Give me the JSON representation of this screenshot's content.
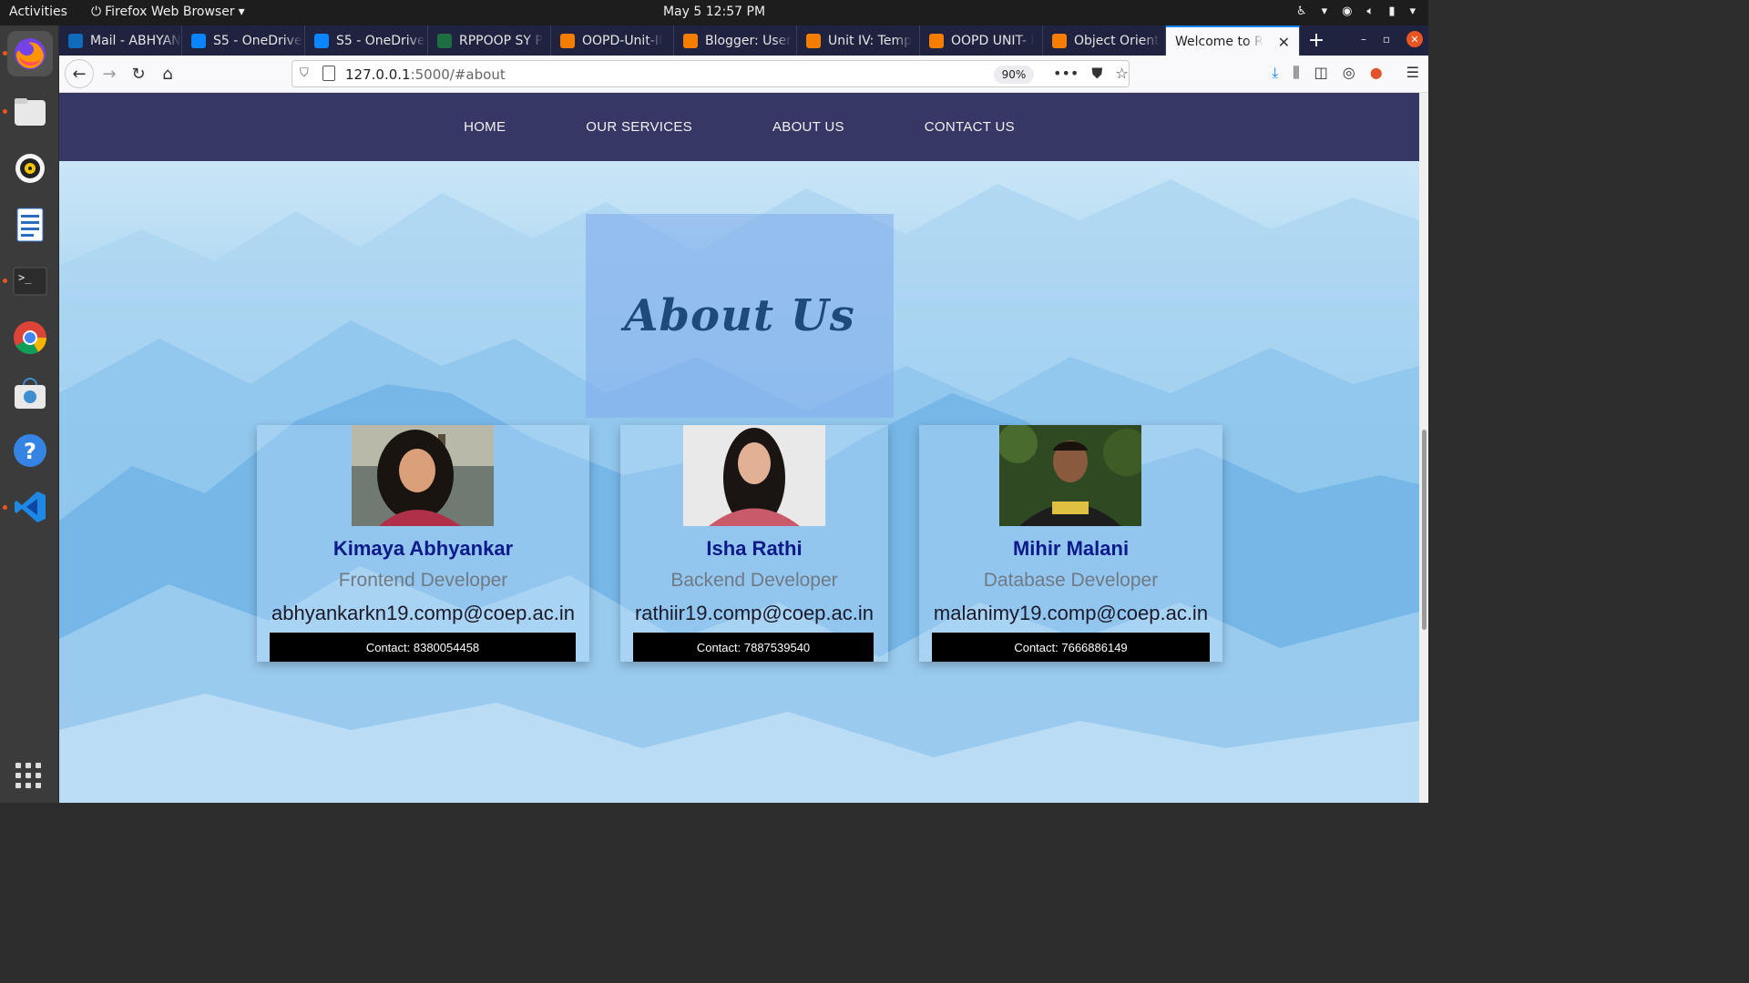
{
  "topbar": {
    "activities": "Activities",
    "app_name": "Firefox Web Browser",
    "clock": "May 5  12:57 PM"
  },
  "tabs": [
    {
      "label": "Mail - ABHYANKAR",
      "icon": "outlook-icon",
      "color": "#0f6cbd"
    },
    {
      "label": "S5 - OneDrive",
      "icon": "onedrive-icon",
      "color": "#0a84ff"
    },
    {
      "label": "S5 - OneDrive",
      "icon": "onedrive-icon",
      "color": "#0a84ff"
    },
    {
      "label": "RPPOOP SY P",
      "icon": "excel-icon",
      "color": "#1d6f42"
    },
    {
      "label": "OOPD-Unit-II",
      "icon": "blogger-icon",
      "color": "#f57d00"
    },
    {
      "label": "Blogger: User",
      "icon": "blogger-icon",
      "color": "#f57d00"
    },
    {
      "label": "Unit IV: Temp",
      "icon": "blogger-icon",
      "color": "#f57d00"
    },
    {
      "label": "OOPD UNIT- I",
      "icon": "blogger-icon",
      "color": "#f57d00"
    },
    {
      "label": "Object Orient",
      "icon": "blogger-icon",
      "color": "#f57d00"
    },
    {
      "label": "Welcome to R",
      "icon": "",
      "active": true
    }
  ],
  "url": {
    "host": "127.0.0.1",
    "path": ":5000/#about",
    "zoom": "90%"
  },
  "site_nav": [
    "HOME",
    "OUR SERVICES",
    "ABOUT US",
    "CONTACT US"
  ],
  "about": {
    "title": "About Us"
  },
  "team": [
    {
      "name": "Kimaya Abhyankar",
      "role": "Frontend Developer",
      "email": "abhyankarkn19.comp@coep.ac.in",
      "contact": "Contact: 8380054458"
    },
    {
      "name": "Isha Rathi",
      "role": "Backend Developer",
      "email": "rathiir19.comp@coep.ac.in",
      "contact": "Contact: 7887539540"
    },
    {
      "name": "Mihir Malani",
      "role": "Database Developer",
      "email": "malanimy19.comp@coep.ac.in",
      "contact": "Contact: 7666886149"
    }
  ],
  "colors": {
    "nav_bg": "#363765",
    "name_color": "#0d1a8a",
    "accent": "#0a84ff",
    "ubuntu_orange": "#e95420"
  }
}
